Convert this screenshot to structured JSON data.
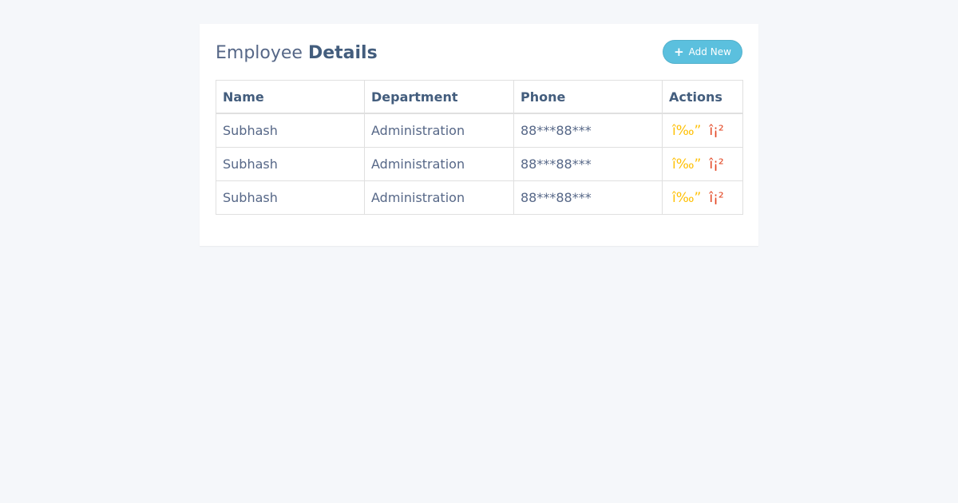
{
  "page": {
    "title_regular": "Employee",
    "title_bold": "Details",
    "add_button": {
      "icon": "plus-icon",
      "icon_glyph": "+",
      "label": "Add New"
    }
  },
  "table": {
    "columns": [
      "Name",
      "Department",
      "Phone",
      "Actions"
    ],
    "rows": [
      {
        "name": "Subhash",
        "department": "Administration",
        "phone": "88***88***",
        "edit": "î‰”",
        "delete": "î¡²"
      },
      {
        "name": "Subhash",
        "department": "Administration",
        "phone": "88***88***",
        "edit": "î‰”",
        "delete": "î¡²"
      },
      {
        "name": "Subhash",
        "department": "Administration",
        "phone": "88***88***",
        "edit": "î‰”",
        "delete": "î¡²"
      }
    ]
  },
  "colors": {
    "background": "#f5f7fa",
    "card": "#ffffff",
    "accent": "#5bc0de",
    "text": "#566787",
    "heading": "#435d7d",
    "edit": "#ffc107",
    "delete": "#e34724"
  }
}
